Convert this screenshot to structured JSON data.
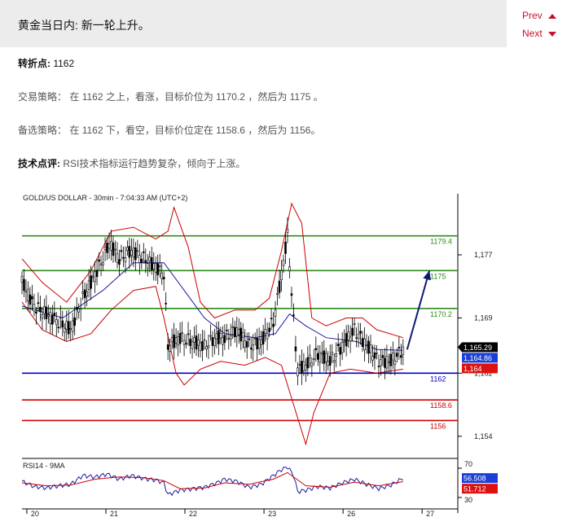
{
  "header": {
    "title": "黄金当日内: 新一轮上升。",
    "prev_label": "Prev",
    "next_label": "Next"
  },
  "analysis": {
    "pivot_label": "转折点:",
    "pivot_value": "1162",
    "strategy_label": "交易策略：",
    "strategy_text": "在 1162 之上，看涨，目标价位为 1170.2 ，然后为 1175 。",
    "alt_label": "备选策略：",
    "alt_text": "在 1162 下，看空，目标价位定在 1158.6 ，然后为 1156。",
    "tech_label": "技术点评:",
    "tech_text": "RSI技术指标运行趋势复杂，倾向于上涨。"
  },
  "colors": {
    "resistance": "#2e8b1a",
    "support": "#cc0000",
    "pivot": "#0000cc",
    "candle": "#000000",
    "bollinger": "#cc0000",
    "moving_average": "#1a1aa0",
    "rsi": "#1a1aa0",
    "rsi_ma": "#cc0000",
    "arrow": "#0d1a6e"
  },
  "chart_data": {
    "type": "candlestick",
    "title": "GOLD/US DOLLAR - 30min - 7:04:33 AM (UTC+2)",
    "ylim": [
      1151.5,
      1183.5
    ],
    "yticks": [
      1154,
      1162,
      1169,
      1177
    ],
    "xlabels": [
      "20",
      "21",
      "22",
      "23",
      "26",
      "27"
    ],
    "levels": [
      {
        "value": 1179.4,
        "label": "1179.4",
        "kind": "resistance"
      },
      {
        "value": 1175,
        "label": "1175",
        "kind": "resistance"
      },
      {
        "value": 1170.2,
        "label": "1170.2",
        "kind": "resistance"
      },
      {
        "value": 1162,
        "label": "1162",
        "kind": "pivot"
      },
      {
        "value": 1158.6,
        "label": "1158.6",
        "kind": "support"
      },
      {
        "value": 1156,
        "label": "1156",
        "kind": "support"
      }
    ],
    "price_tags": [
      {
        "value": 1165.29,
        "label": "1,165.29",
        "kind": "last"
      },
      {
        "value": 1164.86,
        "label": "1,164.86",
        "kind": "ma"
      },
      {
        "value": 1164,
        "label": "1,164",
        "kind": "band"
      }
    ],
    "arrow": {
      "from_bar": 190,
      "from_price": 1165.0,
      "to_bar": 201,
      "to_price": 1175.0
    },
    "price": [
      {
        "bar": 0,
        "v": 1173.5
      },
      {
        "bar": 6,
        "v": 1170.5
      },
      {
        "bar": 12,
        "v": 1169.5
      },
      {
        "bar": 18,
        "v": 1168.5
      },
      {
        "bar": 24,
        "v": 1167.5
      },
      {
        "bar": 30,
        "v": 1171.5
      },
      {
        "bar": 36,
        "v": 1174.5
      },
      {
        "bar": 40,
        "v": 1176.5
      },
      {
        "bar": 43,
        "v": 1178.5
      },
      {
        "bar": 48,
        "v": 1176.5
      },
      {
        "bar": 54,
        "v": 1177.5
      },
      {
        "bar": 60,
        "v": 1176.5
      },
      {
        "bar": 66,
        "v": 1175.5
      },
      {
        "bar": 70,
        "v": 1174.5
      },
      {
        "bar": 72,
        "v": 1165.5
      },
      {
        "bar": 78,
        "v": 1166.5
      },
      {
        "bar": 84,
        "v": 1166.0
      },
      {
        "bar": 90,
        "v": 1165.5
      },
      {
        "bar": 96,
        "v": 1166.5
      },
      {
        "bar": 100,
        "v": 1166.5
      },
      {
        "bar": 106,
        "v": 1167.5
      },
      {
        "bar": 112,
        "v": 1165.5
      },
      {
        "bar": 118,
        "v": 1166.0
      },
      {
        "bar": 124,
        "v": 1168.5
      },
      {
        "bar": 128,
        "v": 1174.5
      },
      {
        "bar": 131,
        "v": 1179.5
      },
      {
        "bar": 134,
        "v": 1168.5
      },
      {
        "bar": 136,
        "v": 1162.5
      },
      {
        "bar": 140,
        "v": 1163.0
      },
      {
        "bar": 146,
        "v": 1164.5
      },
      {
        "bar": 152,
        "v": 1163.5
      },
      {
        "bar": 158,
        "v": 1165.5
      },
      {
        "bar": 164,
        "v": 1167.5
      },
      {
        "bar": 170,
        "v": 1165.5
      },
      {
        "bar": 176,
        "v": 1163.5
      },
      {
        "bar": 182,
        "v": 1163.5
      },
      {
        "bar": 188,
        "v": 1165.0
      }
    ],
    "moving_average": [
      {
        "bar": 0,
        "v": 1170.5
      },
      {
        "bar": 20,
        "v": 1169.0
      },
      {
        "bar": 40,
        "v": 1172.5
      },
      {
        "bar": 55,
        "v": 1176.0
      },
      {
        "bar": 70,
        "v": 1176.0
      },
      {
        "bar": 80,
        "v": 1172.5
      },
      {
        "bar": 90,
        "v": 1169.0
      },
      {
        "bar": 100,
        "v": 1167.0
      },
      {
        "bar": 115,
        "v": 1166.5
      },
      {
        "bar": 125,
        "v": 1167.0
      },
      {
        "bar": 132,
        "v": 1169.5
      },
      {
        "bar": 140,
        "v": 1168.0
      },
      {
        "bar": 150,
        "v": 1166.5
      },
      {
        "bar": 165,
        "v": 1166.0
      },
      {
        "bar": 175,
        "v": 1165.0
      },
      {
        "bar": 188,
        "v": 1164.9
      }
    ],
    "bollinger_upper": [
      {
        "bar": 0,
        "v": 1176.5
      },
      {
        "bar": 10,
        "v": 1173.5
      },
      {
        "bar": 22,
        "v": 1171.0
      },
      {
        "bar": 34,
        "v": 1175.0
      },
      {
        "bar": 44,
        "v": 1180.0
      },
      {
        "bar": 55,
        "v": 1180.5
      },
      {
        "bar": 66,
        "v": 1179.0
      },
      {
        "bar": 72,
        "v": 1180.0
      },
      {
        "bar": 75,
        "v": 1183.0
      },
      {
        "bar": 82,
        "v": 1178.0
      },
      {
        "bar": 88,
        "v": 1171.0
      },
      {
        "bar": 95,
        "v": 1169.0
      },
      {
        "bar": 105,
        "v": 1170.0
      },
      {
        "bar": 115,
        "v": 1170.0
      },
      {
        "bar": 122,
        "v": 1171.5
      },
      {
        "bar": 128,
        "v": 1177.5
      },
      {
        "bar": 133,
        "v": 1183.5
      },
      {
        "bar": 138,
        "v": 1181.0
      },
      {
        "bar": 143,
        "v": 1169.0
      },
      {
        "bar": 150,
        "v": 1168.0
      },
      {
        "bar": 160,
        "v": 1169.0
      },
      {
        "bar": 168,
        "v": 1169.0
      },
      {
        "bar": 175,
        "v": 1167.5
      },
      {
        "bar": 188,
        "v": 1166.5
      }
    ],
    "bollinger_lower": [
      {
        "bar": 0,
        "v": 1171.0
      },
      {
        "bar": 10,
        "v": 1167.5
      },
      {
        "bar": 22,
        "v": 1166.0
      },
      {
        "bar": 34,
        "v": 1167.0
      },
      {
        "bar": 44,
        "v": 1170.0
      },
      {
        "bar": 55,
        "v": 1172.5
      },
      {
        "bar": 66,
        "v": 1173.0
      },
      {
        "bar": 70,
        "v": 1169.0
      },
      {
        "bar": 76,
        "v": 1162.0
      },
      {
        "bar": 80,
        "v": 1160.5
      },
      {
        "bar": 88,
        "v": 1162.5
      },
      {
        "bar": 98,
        "v": 1163.5
      },
      {
        "bar": 110,
        "v": 1163.0
      },
      {
        "bar": 120,
        "v": 1164.0
      },
      {
        "bar": 128,
        "v": 1163.0
      },
      {
        "bar": 134,
        "v": 1158.0
      },
      {
        "bar": 140,
        "v": 1153.0
      },
      {
        "bar": 144,
        "v": 1157.0
      },
      {
        "bar": 152,
        "v": 1162.0
      },
      {
        "bar": 162,
        "v": 1162.5
      },
      {
        "bar": 175,
        "v": 1162.0
      },
      {
        "bar": 188,
        "v": 1162.5
      }
    ],
    "rsi": {
      "label": "RSI14 - 9MA",
      "ylim": [
        20,
        80
      ],
      "yticks": [
        30,
        70
      ],
      "value_label": "56.508",
      "ma_label": "51.712",
      "values": [
        {
          "bar": 0,
          "v": 52
        },
        {
          "bar": 6,
          "v": 45
        },
        {
          "bar": 12,
          "v": 43
        },
        {
          "bar": 18,
          "v": 46
        },
        {
          "bar": 24,
          "v": 48
        },
        {
          "bar": 30,
          "v": 60
        },
        {
          "bar": 36,
          "v": 58
        },
        {
          "bar": 42,
          "v": 62
        },
        {
          "bar": 48,
          "v": 55
        },
        {
          "bar": 54,
          "v": 60
        },
        {
          "bar": 60,
          "v": 56
        },
        {
          "bar": 66,
          "v": 54
        },
        {
          "bar": 70,
          "v": 50
        },
        {
          "bar": 72,
          "v": 34
        },
        {
          "bar": 78,
          "v": 40
        },
        {
          "bar": 84,
          "v": 42
        },
        {
          "bar": 90,
          "v": 44
        },
        {
          "bar": 96,
          "v": 50
        },
        {
          "bar": 100,
          "v": 55
        },
        {
          "bar": 106,
          "v": 52
        },
        {
          "bar": 112,
          "v": 44
        },
        {
          "bar": 118,
          "v": 48
        },
        {
          "bar": 124,
          "v": 60
        },
        {
          "bar": 128,
          "v": 68
        },
        {
          "bar": 131,
          "v": 72
        },
        {
          "bar": 134,
          "v": 60
        },
        {
          "bar": 136,
          "v": 38
        },
        {
          "bar": 140,
          "v": 40
        },
        {
          "bar": 146,
          "v": 45
        },
        {
          "bar": 152,
          "v": 43
        },
        {
          "bar": 158,
          "v": 50
        },
        {
          "bar": 164,
          "v": 55
        },
        {
          "bar": 170,
          "v": 48
        },
        {
          "bar": 176,
          "v": 42
        },
        {
          "bar": 182,
          "v": 47
        },
        {
          "bar": 188,
          "v": 56.5
        }
      ],
      "ma": [
        {
          "bar": 0,
          "v": 50
        },
        {
          "bar": 12,
          "v": 46
        },
        {
          "bar": 24,
          "v": 47
        },
        {
          "bar": 36,
          "v": 55
        },
        {
          "bar": 48,
          "v": 58
        },
        {
          "bar": 60,
          "v": 57
        },
        {
          "bar": 70,
          "v": 53
        },
        {
          "bar": 78,
          "v": 42
        },
        {
          "bar": 90,
          "v": 43
        },
        {
          "bar": 100,
          "v": 50
        },
        {
          "bar": 112,
          "v": 48
        },
        {
          "bar": 124,
          "v": 55
        },
        {
          "bar": 131,
          "v": 64
        },
        {
          "bar": 140,
          "v": 46
        },
        {
          "bar": 152,
          "v": 44
        },
        {
          "bar": 164,
          "v": 51
        },
        {
          "bar": 176,
          "v": 46
        },
        {
          "bar": 188,
          "v": 51.7
        }
      ]
    }
  }
}
